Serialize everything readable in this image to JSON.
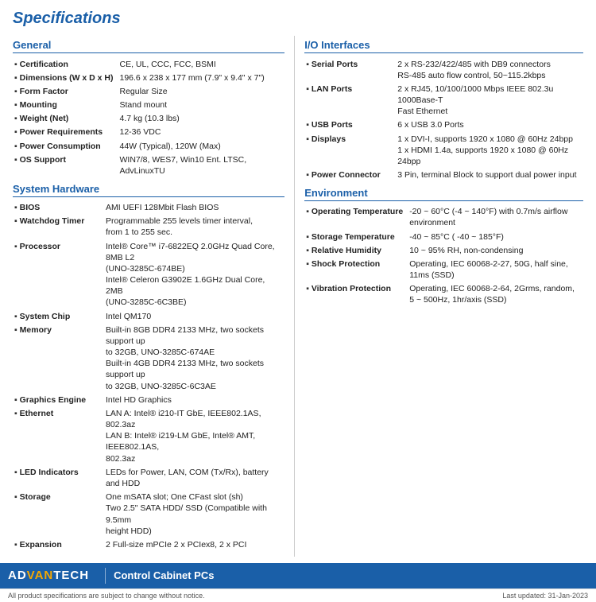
{
  "page": {
    "title": "Specifications"
  },
  "footer": {
    "logo_advan": "AD",
    "logo_full": "ADVANTECH",
    "product": "Control Cabinet PCs",
    "note_left": "All product specifications are subject to change without notice.",
    "note_right": "Last updated: 31-Jan-2023"
  },
  "general": {
    "section_title": "General",
    "rows": [
      {
        "label": "Certification",
        "value": "CE, UL, CCC, FCC, BSMI"
      },
      {
        "label": "Dimensions (W x D x H)",
        "value": "196.6 x 238 x 177 mm (7.9\" x 9.4\" x 7\")"
      },
      {
        "label": "Form Factor",
        "value": "Regular Size"
      },
      {
        "label": "Mounting",
        "value": "Stand mount"
      },
      {
        "label": "Weight (Net)",
        "value": "4.7 kg (10.3 lbs)"
      },
      {
        "label": "Power Requirements",
        "value": "12-36 VDC"
      },
      {
        "label": "Power Consumption",
        "value": "44W (Typical), 120W (Max)"
      },
      {
        "label": "OS Support",
        "value": "WIN7/8, WES7, Win10 Ent. LTSC, AdvLinuxTU"
      }
    ]
  },
  "system_hardware": {
    "section_title": "System Hardware",
    "rows": [
      {
        "label": "BIOS",
        "value": "AMI UEFI 128Mbit Flash BIOS"
      },
      {
        "label": "Watchdog Timer",
        "value": "Programmable 255 levels timer interval,\nfrom 1 to 255 sec."
      },
      {
        "label": "Processor",
        "value": "Intel® Core™ i7-6822EQ 2.0GHz Quad Core, 8MB L2\n(UNO-3285C-674BE)\nIntel® Celeron G3902E 1.6GHz Dual Core, 2MB\n(UNO-3285C-6C3BE)"
      },
      {
        "label": "System Chip",
        "value": "Intel QM170"
      },
      {
        "label": "Memory",
        "value": "Built-in 8GB DDR4 2133 MHz, two sockets support up\nto 32GB, UNO-3285C-674AE\nBuilt-in 4GB DDR4 2133 MHz, two sockets support up\nto 32GB, UNO-3285C-6C3AE"
      },
      {
        "label": "Graphics Engine",
        "value": "Intel HD Graphics"
      },
      {
        "label": "Ethernet",
        "value": "LAN A: Intel® i210-IT GbE, IEEE802.1AS, 802.3az\nLAN B: Intel® i219-LM GbE, Intel® AMT, IEEE802.1AS,\n802.3az"
      },
      {
        "label": "LED Indicators",
        "value": "LEDs for Power, LAN, COM (Tx/Rx), battery and HDD"
      },
      {
        "label": "Storage",
        "value": "One mSATA slot; One CFast slot (sh)\nTwo 2.5\" SATA HDD/ SSD (Compatible with 9.5mm\nheight HDD)"
      },
      {
        "label": "Expansion",
        "value": "2 Full-size mPCIe 2 x PCIex8, 2 x PCI"
      }
    ]
  },
  "io_interfaces": {
    "section_title": "I/O Interfaces",
    "rows": [
      {
        "label": "Serial Ports",
        "value": "2 x RS-232/422/485 with DB9 connectors\nRS-485 auto flow control, 50~115.2kbps"
      },
      {
        "label": "LAN Ports",
        "value": "2 x RJ45, 10/100/1000 Mbps IEEE 802.3u 1000Base-T\nFast Ethernet"
      },
      {
        "label": "USB Ports",
        "value": "6 x USB 3.0 Ports"
      },
      {
        "label": "Displays",
        "value": "1 x DVI-I, supports 1920 x 1080 @ 60Hz 24bpp\n1 x HDMI 1.4a, supports 1920 x 1080 @ 60Hz 24bpp"
      },
      {
        "label": "Power Connector",
        "value": "3 Pin, terminal Block to support dual power input"
      }
    ]
  },
  "environment": {
    "section_title": "Environment",
    "rows": [
      {
        "label": "Operating Temperature",
        "value": "-20 ~ 60°C (-4 ~ 140°F) with 0.7m/s airflow\nenvironment"
      },
      {
        "label": "Storage Temperature",
        "value": "-40 ~ 85°C ( -40 ~ 185°F)"
      },
      {
        "label": "Relative Humidity",
        "value": "10 ~ 95% RH, non-condensing"
      },
      {
        "label": "Shock Protection",
        "value": "Operating, IEC 60068-2-27, 50G, half sine,\n11ms (SSD)"
      },
      {
        "label": "Vibration Protection",
        "value": "Operating, IEC 60068-2-64, 2Grms, random,\n5 ~ 500Hz, 1hr/axis (SSD)"
      }
    ]
  }
}
